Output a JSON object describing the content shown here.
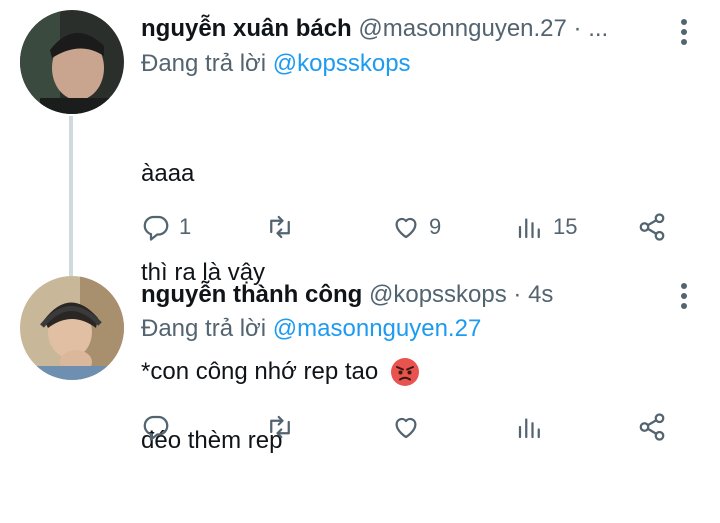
{
  "tweets": [
    {
      "author_name": "nguyễn xuân bách",
      "handle_time": "@masonnguyen.27 · ...",
      "replying_prefix": "Đang trả lời ",
      "replying_to": "@kopsskops",
      "body_lines": [
        "àaaa",
        "thì ra là vậy",
        "*con công nhớ rep tao"
      ],
      "emoji": "angry-face",
      "actions": {
        "reply": "1",
        "retweet": "",
        "like": "9",
        "views": "15"
      }
    },
    {
      "author_name": "nguyễn thành công",
      "handle_time": "@kopsskops · 4s",
      "replying_prefix": "Đang trả lời ",
      "replying_to": "@masonnguyen.27",
      "body_lines": [
        "đéo thèm rep"
      ],
      "actions": {
        "reply": "",
        "retweet": "",
        "like": "",
        "views": ""
      }
    }
  ],
  "colors": {
    "accent": "#1d9bf0",
    "muted": "#536471",
    "emoji_face": "#e8534f"
  }
}
